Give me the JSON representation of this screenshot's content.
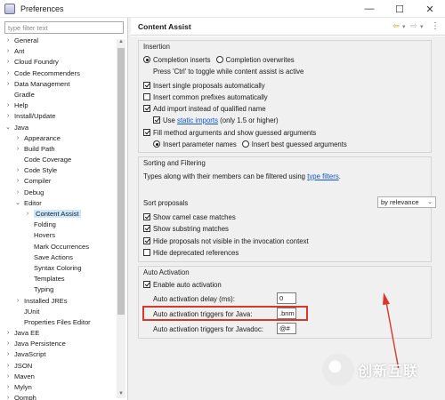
{
  "window": {
    "title": "Preferences",
    "buttons": [
      "—",
      "☐",
      "✕"
    ]
  },
  "filter": {
    "placeholder": "type filter text"
  },
  "tree": [
    {
      "label": "General",
      "level": 0,
      "arrow": "›"
    },
    {
      "label": "Ant",
      "level": 0,
      "arrow": "›"
    },
    {
      "label": "Cloud Foundry",
      "level": 0,
      "arrow": "›"
    },
    {
      "label": "Code Recommenders",
      "level": 0,
      "arrow": "›"
    },
    {
      "label": "Data Management",
      "level": 0,
      "arrow": "›"
    },
    {
      "label": "Gradle",
      "level": 0,
      "arrow": ""
    },
    {
      "label": "Help",
      "level": 0,
      "arrow": "›"
    },
    {
      "label": "Install/Update",
      "level": 0,
      "arrow": "›"
    },
    {
      "label": "Java",
      "level": 0,
      "arrow": "⌄"
    },
    {
      "label": "Appearance",
      "level": 1,
      "arrow": "›"
    },
    {
      "label": "Build Path",
      "level": 1,
      "arrow": "›"
    },
    {
      "label": "Code Coverage",
      "level": 1,
      "arrow": ""
    },
    {
      "label": "Code Style",
      "level": 1,
      "arrow": "›"
    },
    {
      "label": "Compiler",
      "level": 1,
      "arrow": "›"
    },
    {
      "label": "Debug",
      "level": 1,
      "arrow": "›"
    },
    {
      "label": "Editor",
      "level": 1,
      "arrow": "⌄"
    },
    {
      "label": "Content Assist",
      "level": 2,
      "arrow": "›",
      "selected": true
    },
    {
      "label": "Folding",
      "level": 2,
      "arrow": ""
    },
    {
      "label": "Hovers",
      "level": 2,
      "arrow": ""
    },
    {
      "label": "Mark Occurrences",
      "level": 2,
      "arrow": ""
    },
    {
      "label": "Save Actions",
      "level": 2,
      "arrow": ""
    },
    {
      "label": "Syntax Coloring",
      "level": 2,
      "arrow": ""
    },
    {
      "label": "Templates",
      "level": 2,
      "arrow": ""
    },
    {
      "label": "Typing",
      "level": 2,
      "arrow": ""
    },
    {
      "label": "Installed JREs",
      "level": 1,
      "arrow": "›"
    },
    {
      "label": "JUnit",
      "level": 1,
      "arrow": ""
    },
    {
      "label": "Properties Files Editor",
      "level": 1,
      "arrow": ""
    },
    {
      "label": "Java EE",
      "level": 0,
      "arrow": "›"
    },
    {
      "label": "Java Persistence",
      "level": 0,
      "arrow": "›"
    },
    {
      "label": "JavaScript",
      "level": 0,
      "arrow": "›"
    },
    {
      "label": "JSON",
      "level": 0,
      "arrow": "›"
    },
    {
      "label": "Maven",
      "level": 0,
      "arrow": "›"
    },
    {
      "label": "Mylyn",
      "level": 0,
      "arrow": "›"
    },
    {
      "label": "Oomph",
      "level": 0,
      "arrow": "›"
    }
  ],
  "page": {
    "title": "Content Assist"
  },
  "insertion": {
    "title": "Insertion",
    "completion_inserts": "Completion inserts",
    "completion_overwrites": "Completion overwrites",
    "ctrl_hint": "Press 'Ctrl' to toggle while content assist is active",
    "insert_single": "Insert single proposals automatically",
    "insert_prefixes": "Insert common prefixes automatically",
    "add_import": "Add import instead of qualified name",
    "use_label": "Use",
    "static_imports": "static imports",
    "use_suffix": "(only 1.5 or higher)",
    "fill_method": "Fill method arguments and show guessed arguments",
    "insert_param_names": "Insert parameter names",
    "insert_best_guessed": "Insert best guessed arguments"
  },
  "sorting": {
    "title": "Sorting and Filtering",
    "types_text": "Types along with their members can be filtered using",
    "type_filters": "type filters",
    "types_suffix": ".",
    "sort_proposals": "Sort proposals",
    "sort_value": "by relevance",
    "show_camel": "Show camel case matches",
    "show_substring": "Show substring matches",
    "hide_not_visible": "Hide proposals not visible in the invocation context",
    "hide_deprecated": "Hide deprecated references"
  },
  "auto": {
    "title": "Auto Activation",
    "enable": "Enable auto activation",
    "delay_label": "Auto activation delay (ms):",
    "delay_value": "0",
    "java_label": "Auto activation triggers for Java:",
    "java_value": ".bnm",
    "javadoc_label": "Auto activation triggers for Javadoc:",
    "javadoc_value": "@#"
  },
  "watermark": {
    "text": "创新互联"
  },
  "colors": {
    "accent_red": "#d8382c",
    "link": "#1155cc",
    "selection": "#cce8ff"
  }
}
